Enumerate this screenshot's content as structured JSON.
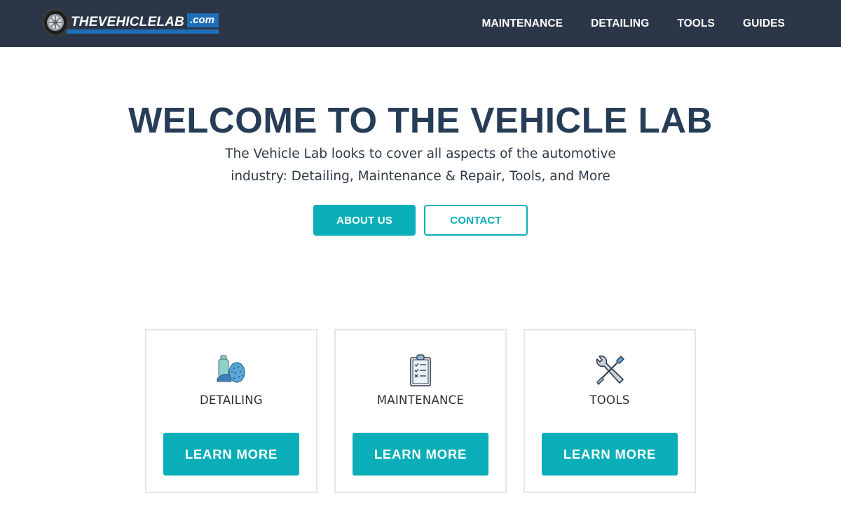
{
  "header": {
    "logo": {
      "text": "THEVEHICLELAB",
      "tld": ".com",
      "icon": "wheel-icon"
    },
    "nav": [
      {
        "label": "MAINTENANCE"
      },
      {
        "label": "DETAILING"
      },
      {
        "label": "TOOLS"
      },
      {
        "label": "GUIDES"
      }
    ]
  },
  "hero": {
    "title": "WELCOME TO THE VEHICLE LAB",
    "subtitle": "The Vehicle Lab looks to cover all aspects of the automotive industry: Detailing, Maintenance & Repair, Tools, and More",
    "about_button": "ABOUT US",
    "contact_button": "CONTACT"
  },
  "cards": [
    {
      "label": "DETAILING",
      "icon": "sponge-bottle-icon",
      "button": "LEARN MORE"
    },
    {
      "label": "MAINTENANCE",
      "icon": "clipboard-checklist-icon",
      "button": "LEARN MORE"
    },
    {
      "label": "TOOLS",
      "icon": "wrench-screwdriver-icon",
      "button": "LEARN MORE"
    }
  ],
  "colors": {
    "header_bg": "#2b3748",
    "accent": "#0aaeb8",
    "title": "#273d57",
    "logo_blue": "#1f6fb8"
  }
}
